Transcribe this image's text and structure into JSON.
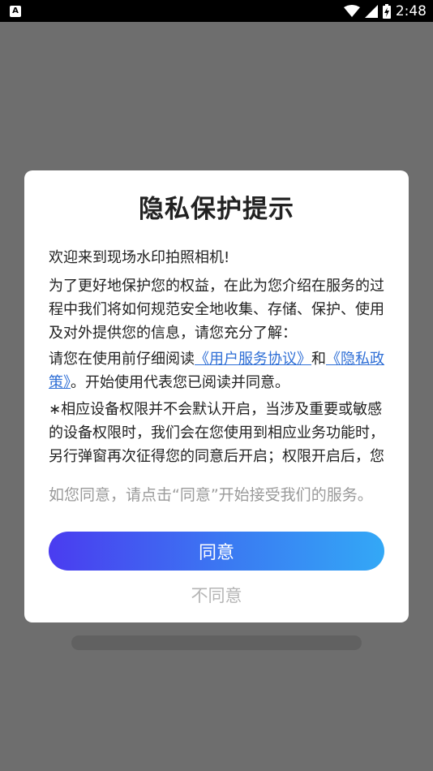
{
  "status_bar": {
    "app_badge": "A",
    "time": "2:48",
    "icons": [
      "wifi-icon",
      "cell-signal-icon",
      "battery-icon"
    ]
  },
  "dialog": {
    "title": "隐私保护提示",
    "welcome": "欢迎来到现场水印拍照相机!",
    "intro": "为了更好地保护您的权益，在此为您介绍在服务的过程中我们将如何规范安全地收集、存储、保护、使用及对外提供您的信息，请您充分了解：",
    "read_prefix": "请您在使用前仔细阅读",
    "user_agreement_link": "《用户服务协议》",
    "and_text": "和",
    "privacy_policy_link": "《隐私政策》",
    "read_suffix": "。开始使用代表您已阅读并同意。",
    "permissions_note": "∗相应设备权限并不会默认开启，当涉及重要或敏感的设备权限时，我们会在您使用到相应业务功能时，另行弹窗再次征得您的同意后开启；权限开启后，您",
    "consent_hint": "如您同意，请点击“同意”开始接受我们的服务。",
    "agree_label": "同意",
    "disagree_label": "不同意"
  },
  "colors": {
    "overlay": "#6e6e6e",
    "link": "#2f6fd6",
    "button_gradient_start": "#4a3cf0",
    "button_gradient_end": "#33a8f6"
  }
}
